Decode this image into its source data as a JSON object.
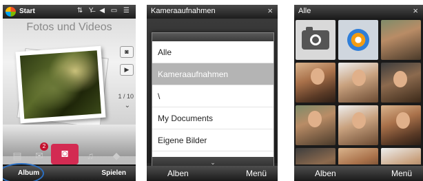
{
  "phone1": {
    "status": {
      "start_label": "Start",
      "icons": "⇅ Y̶ ◀ ▭ ☰"
    },
    "title": "Fotos und Videos",
    "counter": "1 / 10",
    "tabs": {
      "mail_badge": "2"
    },
    "softkeys": {
      "left": "Album",
      "right": "Spielen"
    }
  },
  "phone2": {
    "title": "Kameraaufnahmen",
    "close": "×",
    "menu_items": [
      "Alle",
      "Kameraaufnahmen",
      "\\",
      "My Documents",
      "Eigene Bilder"
    ],
    "selected_index": 1,
    "scroll_indicator": "⌄",
    "softkeys": {
      "left": "Alben",
      "right": "Menü"
    }
  },
  "phone3": {
    "title": "Alle",
    "close": "×",
    "softkeys": {
      "left": "Alben",
      "right": "Menü"
    }
  },
  "colors": {
    "accent": "#d32b52",
    "highlight_circle": "#2b6fc2",
    "menu_selected": "#b4b4b4"
  },
  "icons": [
    "windows-start-icon",
    "camera-icon",
    "video-icon",
    "chevron-down-icon",
    "mail-icon",
    "music-icon",
    "media-player-icon"
  ]
}
